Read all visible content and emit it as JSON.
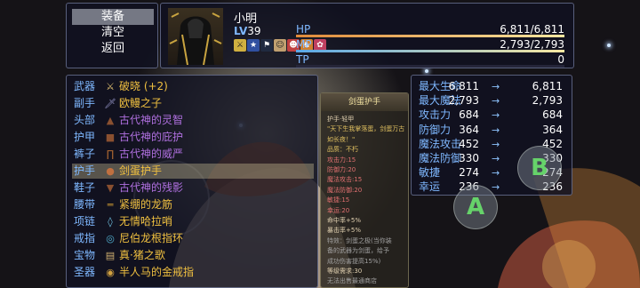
{
  "menu": {
    "items": [
      "装备",
      "清空",
      "返回"
    ],
    "selected_index": 0
  },
  "actor": {
    "name": "小明",
    "level_label": "LV",
    "level": "39",
    "state_icons": [
      "sword-buff-icon",
      "star-icon",
      "flag-icon",
      "face-icon",
      "mask-icon",
      "fox-icon",
      "flower-icon"
    ],
    "hp": {
      "label": "HP",
      "value": "6,811/6,811",
      "ratio": 1.0,
      "color": "#e08a3a"
    },
    "mp": {
      "label": "MP",
      "value": "2,793/2,793",
      "ratio": 1.0,
      "color": "#5aa8e8"
    },
    "tp": {
      "label": "TP",
      "value": "0",
      "ratio": 0.0,
      "color": "#60c060"
    }
  },
  "equipment": {
    "selected_index": 5,
    "rows": [
      {
        "slot": "武器",
        "icon": "sword-icon",
        "glyph": "⚔",
        "icon_color": "#e0c070",
        "name": "破晓 (+2)",
        "name_color": "#f0c040"
      },
      {
        "slot": "副手",
        "icon": "dagger-icon",
        "glyph": "🗡",
        "icon_color": "#9090c0",
        "name": "欧鳗之子",
        "name_color": "#f0c040"
      },
      {
        "slot": "头部",
        "icon": "helmet-icon",
        "glyph": "▲",
        "icon_color": "#8a5030",
        "name": "古代神的灵智",
        "name_color": "#b070e0"
      },
      {
        "slot": "护甲",
        "icon": "armor-icon",
        "glyph": "■",
        "icon_color": "#8a5030",
        "name": "古代神的庇护",
        "name_color": "#b070e0"
      },
      {
        "slot": "裤子",
        "icon": "pants-icon",
        "glyph": "∏",
        "icon_color": "#a06030",
        "name": "古代神的威严",
        "name_color": "#b070e0"
      },
      {
        "slot": "护手",
        "icon": "gauntlet-icon",
        "glyph": "●",
        "icon_color": "#c07040",
        "name": "剑蛋护手",
        "name_color": "#f0c040"
      },
      {
        "slot": "鞋子",
        "icon": "boots-icon",
        "glyph": "▼",
        "icon_color": "#8a5030",
        "name": "古代神的残影",
        "name_color": "#b070e0"
      },
      {
        "slot": "腰带",
        "icon": "belt-icon",
        "glyph": "═",
        "icon_color": "#c09030",
        "name": "紧绷的龙筋",
        "name_color": "#f0c040"
      },
      {
        "slot": "项链",
        "icon": "necklace-icon",
        "glyph": "◊",
        "icon_color": "#70c0e0",
        "name": "无情哈拉哨",
        "name_color": "#f0c040"
      },
      {
        "slot": "戒指",
        "icon": "ring-icon",
        "glyph": "◎",
        "icon_color": "#50b0d0",
        "name": "尼伯龙根指环",
        "name_color": "#f0c040"
      },
      {
        "slot": "宝物",
        "icon": "scroll-icon",
        "glyph": "▤",
        "icon_color": "#d0b070",
        "name": "真·猪之歌",
        "name_color": "#f0c040"
      },
      {
        "slot": "圣器",
        "icon": "relic-icon",
        "glyph": "◉",
        "icon_color": "#d0a040",
        "name": "半人马的金戒指",
        "name_color": "#f0c040"
      }
    ]
  },
  "description": {
    "title": "剑蛋护手",
    "lines": [
      {
        "text": "护手·轻甲",
        "color": "#e0d0b0"
      },
      {
        "text": "\"天下生我掌落蛋，剑蛋万古",
        "color": "#e0c060"
      },
      {
        "text": "如长夜！\"",
        "color": "#e0c060"
      },
      {
        "text": "品质：不朽",
        "color": "#e0c060"
      },
      {
        "text": "攻击力:15",
        "color": "#e07070"
      },
      {
        "text": "防御力:20",
        "color": "#e07070"
      },
      {
        "text": "魔法攻击:15",
        "color": "#e07070"
      },
      {
        "text": "魔法防御:20",
        "color": "#e07070"
      },
      {
        "text": "敏捷:15",
        "color": "#e07070"
      },
      {
        "text": "幸运:20",
        "color": "#e07070"
      },
      {
        "text": "命中率+5%",
        "color": "#e0d0b0"
      },
      {
        "text": "暴击率+5%",
        "color": "#e0d0b0"
      },
      {
        "text": "特效：剑蛋之极(当你装",
        "color": "#a0a0a0"
      },
      {
        "text": "备的武器为剑蛋，给予",
        "color": "#a0a0a0"
      },
      {
        "text": "成功伤害提高15%)",
        "color": "#a0a0a0"
      },
      {
        "text": "等级需求:30",
        "color": "#e0d0b0"
      },
      {
        "text": "无法出售最通商店",
        "color": "#a0a0a0"
      }
    ]
  },
  "params": {
    "arrow": "→",
    "rows": [
      {
        "name": "最大生命",
        "old": "6,811",
        "new": "6,811"
      },
      {
        "name": "最大魔法",
        "old": "2,793",
        "new": "2,793"
      },
      {
        "name": "攻击力",
        "old": "684",
        "new": "684"
      },
      {
        "name": "防御力",
        "old": "364",
        "new": "364"
      },
      {
        "name": "魔法攻击",
        "old": "452",
        "new": "452"
      },
      {
        "name": "魔法防御",
        "old": "330",
        "new": "330"
      },
      {
        "name": "敏捷",
        "old": "274",
        "new": "274"
      },
      {
        "name": "幸运",
        "old": "236",
        "new": "236"
      }
    ]
  },
  "touch": {
    "a_label": "A",
    "b_label": "B"
  }
}
